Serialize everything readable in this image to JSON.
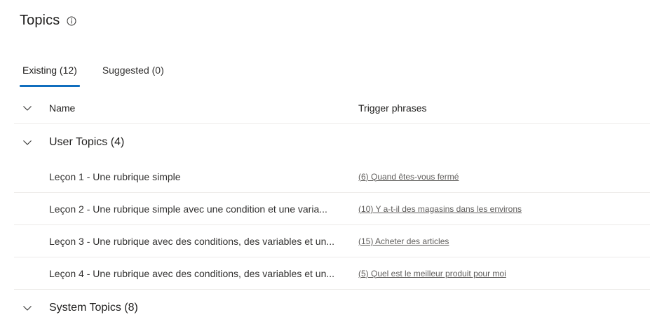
{
  "header": {
    "title": "Topics",
    "info_icon": "info-icon"
  },
  "tabs": [
    {
      "label": "Existing (12)",
      "active": true
    },
    {
      "label": "Suggested (0)",
      "active": false
    }
  ],
  "table": {
    "columns": {
      "name": "Name",
      "trigger": "Trigger phrases"
    },
    "groups": [
      {
        "label": "User Topics (4)",
        "expanded": true,
        "rows": [
          {
            "name": "Leçon 1 - Une rubrique simple",
            "trigger": "(6) Quand êtes-vous fermé"
          },
          {
            "name": "Leçon 2 - Une rubrique simple avec une condition et une varia...",
            "trigger": "(10) Y a-t-il des magasins dans les environs"
          },
          {
            "name": "Leçon 3 - Une rubrique avec des conditions, des variables et un...",
            "trigger": "(15) Acheter des articles"
          },
          {
            "name": "Leçon 4 - Une rubrique avec des conditions, des variables et un...",
            "trigger": "(5) Quel est le meilleur produit pour moi"
          }
        ]
      },
      {
        "label": "System Topics (8)",
        "expanded": true,
        "rows": []
      }
    ]
  },
  "colors": {
    "accent": "#106ebe",
    "text": "#323130",
    "divider": "#edebe9"
  }
}
